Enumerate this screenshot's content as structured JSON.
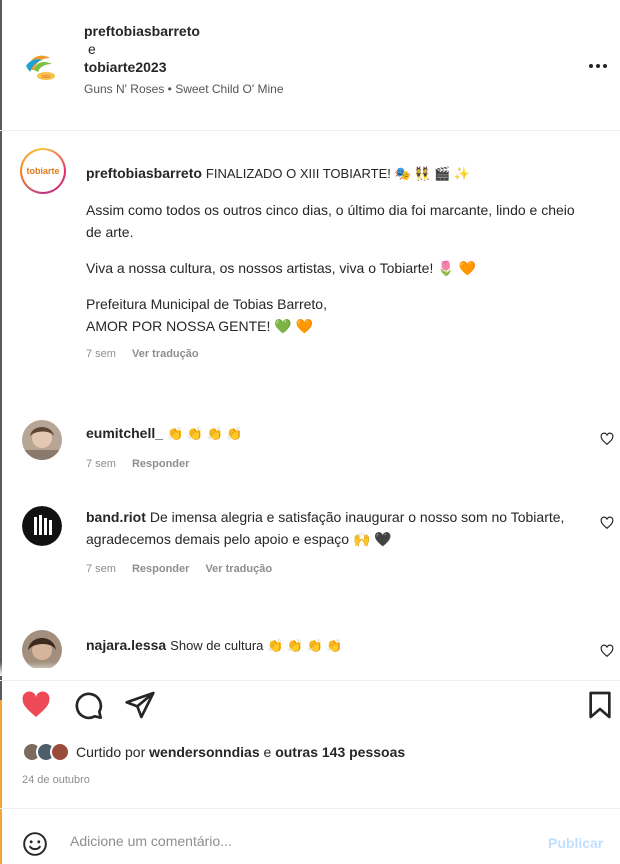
{
  "header": {
    "user1": "preftobiasbarreto",
    "conjunction": "e",
    "user2": "tobiarte2023",
    "song": "Guns N' Roses • Sweet Child O' Mine"
  },
  "caption": {
    "avatar_text": "tobiarte",
    "username": "preftobiasbarreto",
    "line1": "FINALIZADO O XIII TOBIARTE! 🎭 👯 🎬 ✨",
    "para2": "Assim como todos os outros cinco dias, o último dia foi marcante, lindo e cheio de arte.",
    "para3": "Viva a nossa cultura, os nossos artistas, viva o Tobiarte! 🌷 🧡",
    "para4a": "Prefeitura Municipal de Tobias Barreto,",
    "para4b": "AMOR POR NOSSA GENTE! 💚 🧡",
    "time": "7 sem",
    "translate": "Ver tradução"
  },
  "comments": [
    {
      "username": "eumitchell_",
      "text": "👏 👏 👏 👏",
      "time": "7 sem",
      "reply": "Responder",
      "translate": ""
    },
    {
      "username": "band.riot",
      "text": "De imensa alegria e satisfação inaugurar o nosso som no Tobiarte, agradecemos demais pelo apoio e espaço 🙌 🖤",
      "time": "7 sem",
      "reply": "Responder",
      "translate": "Ver tradução"
    },
    {
      "username": "najara.lessa",
      "text": "Show de cultura 👏 👏 👏 👏",
      "time": "",
      "reply": "",
      "translate": ""
    }
  ],
  "likes": {
    "prefix": "Curtido por",
    "user": "wendersonndias",
    "middle": "e",
    "others": "outras 143 pessoas"
  },
  "date": "24 de outubro",
  "add_comment": {
    "placeholder": "Adicione um comentário...",
    "publish": "Publicar"
  },
  "colors": {
    "like_red": "#ed4956",
    "text": "#262626",
    "muted": "#8e8e8e",
    "publish_disabled": "#c0dffd"
  },
  "icons": [
    "heart-icon",
    "comment-icon",
    "share-icon",
    "bookmark-icon",
    "emoji-icon",
    "more-icon"
  ]
}
